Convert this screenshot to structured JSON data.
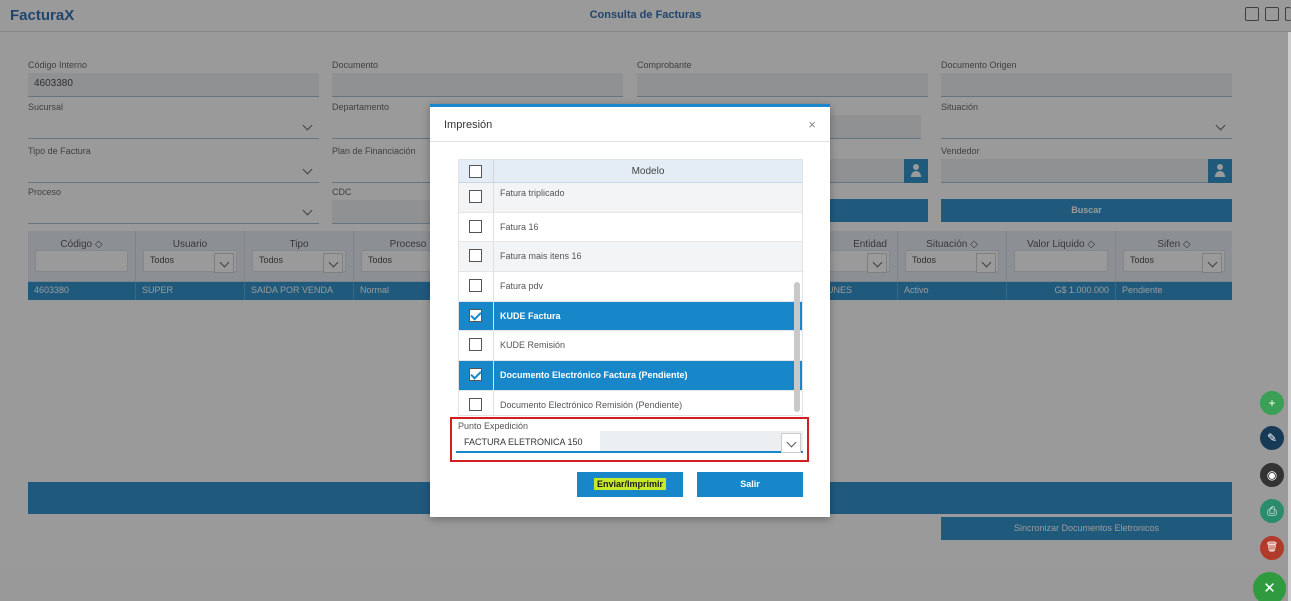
{
  "app": {
    "logo_main": "Factura",
    "logo_x": "X",
    "title": "Consulta de Facturas"
  },
  "form": {
    "codigo_interno": {
      "label": "Código Interno",
      "value": "4603380"
    },
    "documento": {
      "label": "Documento"
    },
    "comprobante": {
      "label": "Comprobante"
    },
    "documento_origen": {
      "label": "Documento Origen"
    },
    "sucursal": {
      "label": "Sucursal"
    },
    "departamento": {
      "label": "Departamento"
    },
    "situacion": {
      "label": "Situación"
    },
    "tipo_factura": {
      "label": "Tipo de Factura"
    },
    "plan_financiacion": {
      "label": "Plan de Financiación"
    },
    "vendedor": {
      "label": "Vendedor"
    },
    "proceso": {
      "label": "Proceso"
    },
    "cdc": {
      "label": "CDC"
    },
    "buscar_label": "Buscar"
  },
  "grid": {
    "headers": [
      {
        "title": "Código ◇",
        "filter": ""
      },
      {
        "title": "Usuario",
        "filter": "Todos"
      },
      {
        "title": "Tipo",
        "filter": "Todos"
      },
      {
        "title": "Proceso",
        "filter": "Todos"
      },
      {
        "title": "Entidad",
        "filter": ""
      },
      {
        "title": "Situación ◇",
        "filter": "Todos"
      },
      {
        "title": "Valor Liquido ◇",
        "filter": ""
      },
      {
        "title": "Sifen ◇",
        "filter": "Todos"
      }
    ],
    "row": [
      "4603380",
      "SUPER",
      "SAIDA POR VENDA",
      "Normal",
      "UNES",
      "Activo",
      "G$ 1.000.000",
      "Pendiente"
    ]
  },
  "sync_button": "Sincronizar Documentos Eletronicos",
  "modal": {
    "title": "Impresión",
    "close": "×",
    "column_title": "Modelo",
    "rows": [
      {
        "label": "Fatura triplicado",
        "checked": false
      },
      {
        "label": "Fatura 16",
        "checked": false
      },
      {
        "label": "Fatura mais itens 16",
        "checked": false
      },
      {
        "label": "Fatura pdv",
        "checked": false
      },
      {
        "label": "KUDE Factura",
        "checked": true
      },
      {
        "label": "KUDE Remisión",
        "checked": false
      },
      {
        "label": "Documento Electrónico Factura (Pendiente)",
        "checked": true
      },
      {
        "label": "Documento Electrónico Remisión (Pendiente)",
        "checked": false
      }
    ],
    "punto_label": "Punto Expedición",
    "punto_value": "FACTURA ELETRONICA 150",
    "btn_enviar": "Enviar/Imprimir",
    "btn_salir": "Salir"
  },
  "fab": {
    "add": "+",
    "edit": "✎",
    "view": "◉",
    "print": "⎙",
    "delete": "🗑",
    "close": "✕"
  }
}
